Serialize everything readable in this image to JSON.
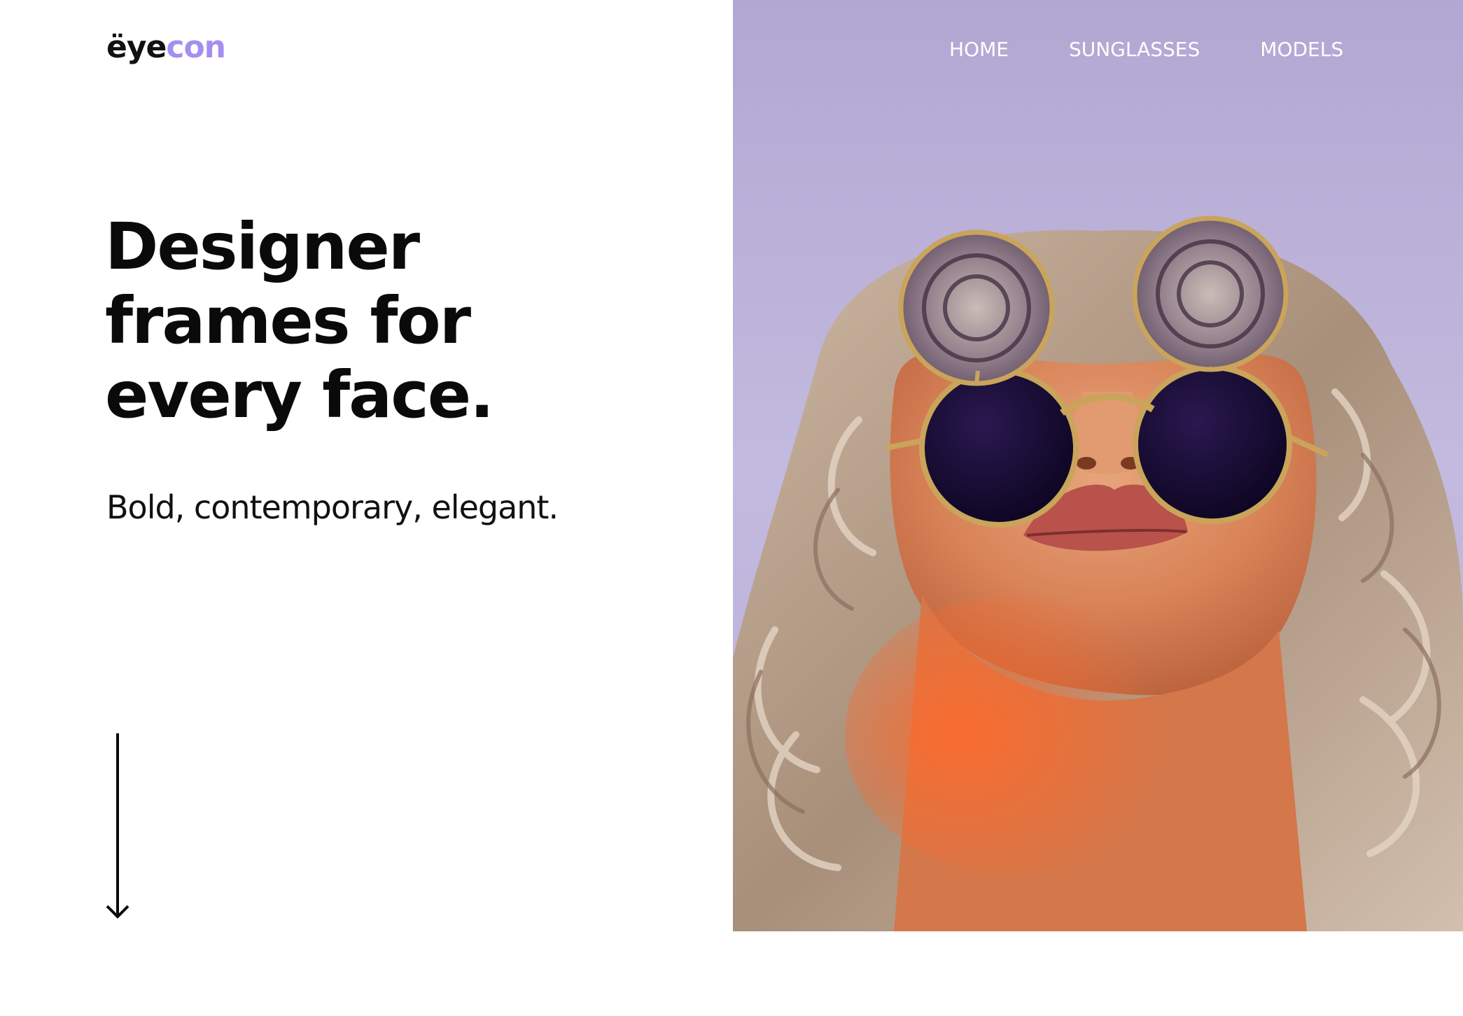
{
  "brand": {
    "logo_part1": "ëye",
    "logo_part2": "con",
    "accent_color": "#a48ff0"
  },
  "nav": {
    "items": [
      {
        "label": "HOME"
      },
      {
        "label": "SUNGLASSES"
      },
      {
        "label": "MODELS"
      }
    ]
  },
  "hero": {
    "headline_lines": [
      "Designer",
      "frames for",
      "every face."
    ],
    "subhead": "Bold, contemporary, elegant.",
    "scroll_icon": "arrow-down-icon",
    "image_subject": "model-with-flip-up-round-sunglasses"
  },
  "colors": {
    "text": "#0a0a0a",
    "background": "#ffffff",
    "image_background": "#b9afd8",
    "nav_text": "#ffffff"
  }
}
